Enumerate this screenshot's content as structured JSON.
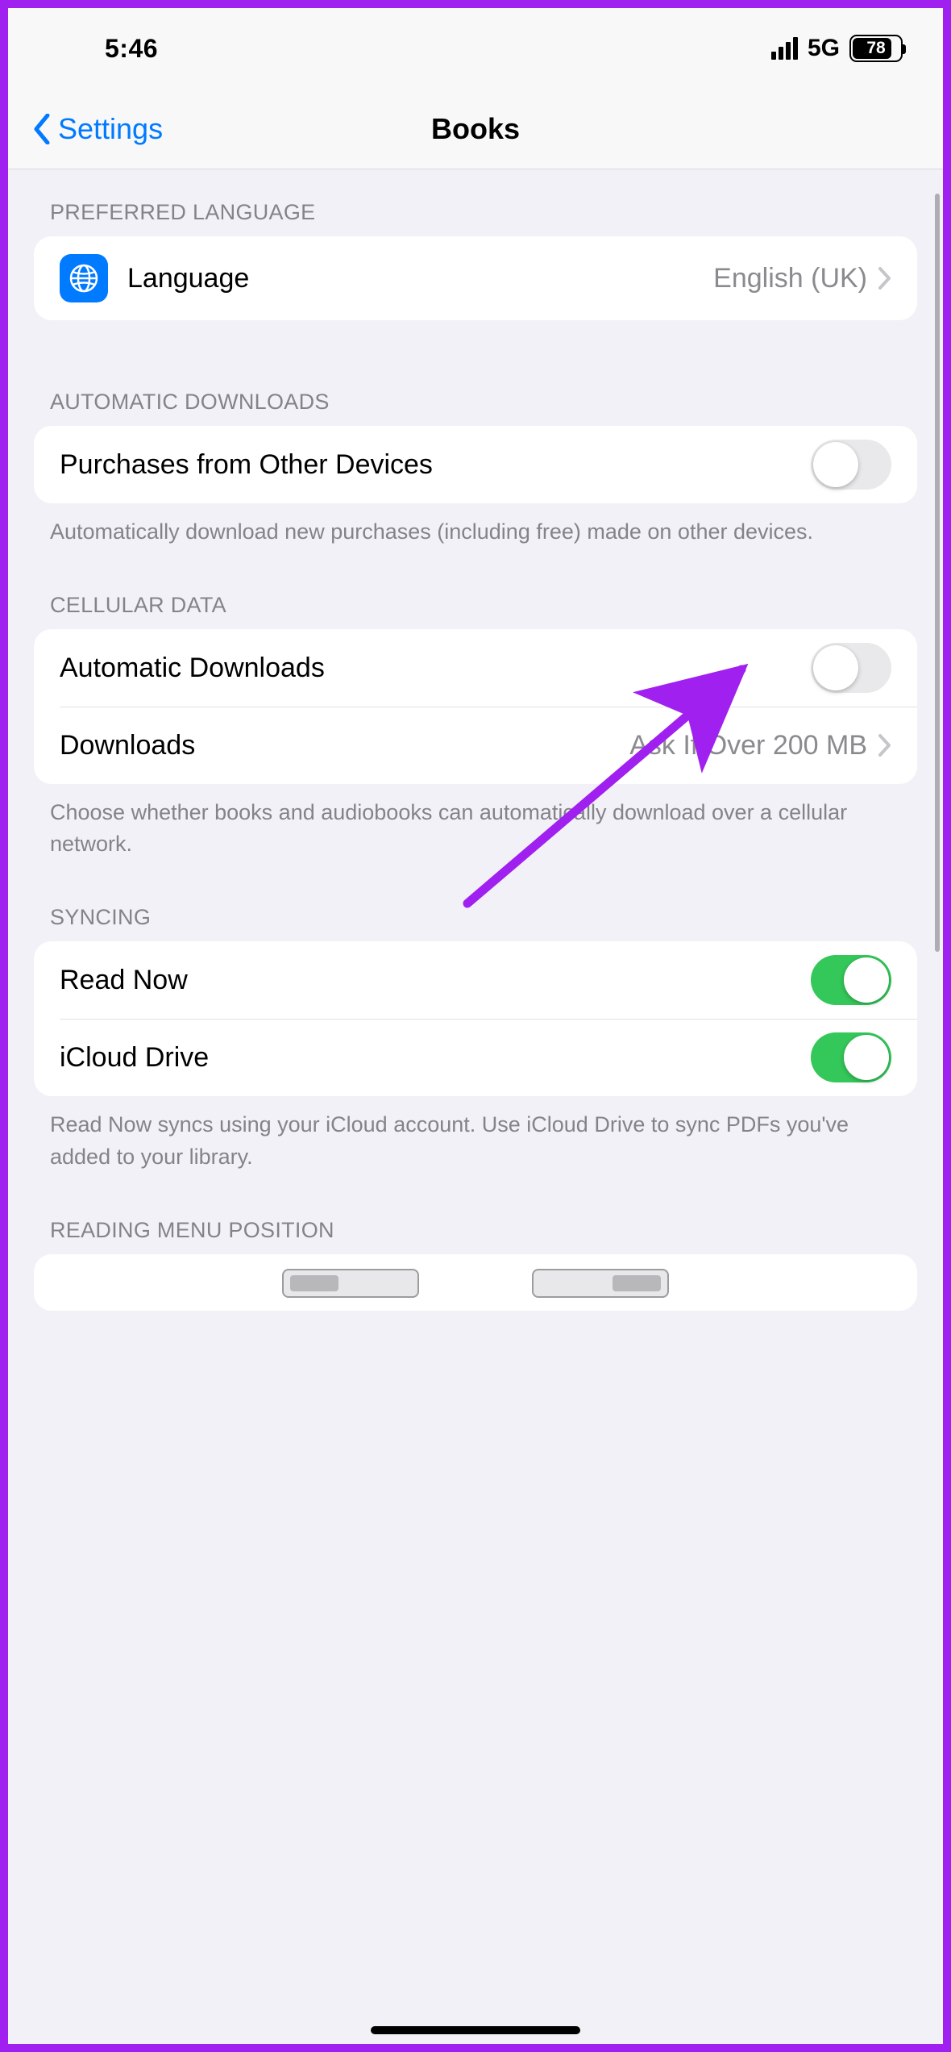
{
  "status": {
    "time": "5:46",
    "network": "5G",
    "battery_percent": 78
  },
  "nav": {
    "back_label": "Settings",
    "title": "Books"
  },
  "sections": {
    "preferred_language": {
      "header": "PREFERRED LANGUAGE",
      "language_row": {
        "label": "Language",
        "value": "English (UK)"
      }
    },
    "automatic_downloads": {
      "header": "AUTOMATIC DOWNLOADS",
      "purchases_row": {
        "label": "Purchases from Other Devices",
        "on": false
      },
      "footer": "Automatically download new purchases (including free) made on other devices."
    },
    "cellular_data": {
      "header": "CELLULAR DATA",
      "auto_downloads_row": {
        "label": "Automatic Downloads",
        "on": false
      },
      "downloads_row": {
        "label": "Downloads",
        "value": "Ask If Over 200 MB"
      },
      "footer": "Choose whether books and audiobooks can automatically download over a cellular network."
    },
    "syncing": {
      "header": "SYNCING",
      "read_now_row": {
        "label": "Read Now",
        "on": true
      },
      "icloud_drive_row": {
        "label": "iCloud Drive",
        "on": true
      },
      "footer": "Read Now syncs using your iCloud account. Use iCloud Drive to sync PDFs you've added to your library."
    },
    "reading_menu_position": {
      "header": "READING MENU POSITION"
    }
  },
  "colors": {
    "accent": "#007aff",
    "toggle_on": "#34c759",
    "annotation": "#a020f0"
  }
}
